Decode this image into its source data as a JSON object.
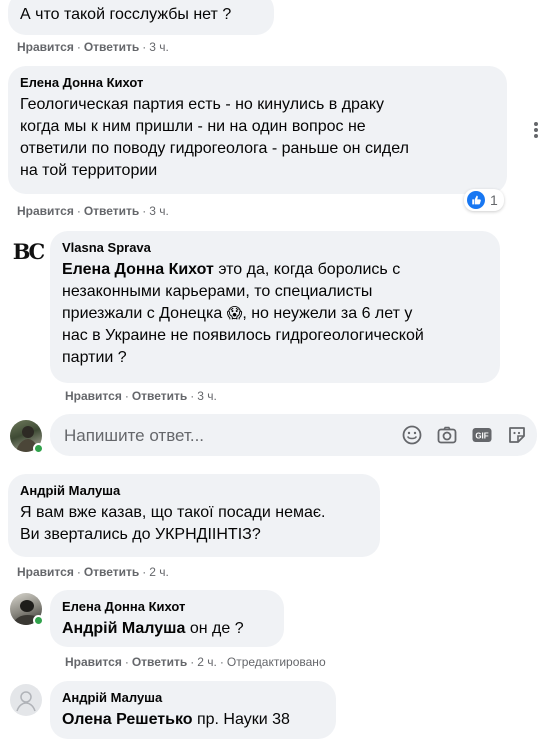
{
  "comments": [
    {
      "text": "А что такой госслужбы нет ?",
      "actions": {
        "like": "Нравится",
        "reply": "Ответить",
        "time": "3 ч."
      }
    },
    {
      "author": "Елена Донна Кихот",
      "text_lines": [
        "Геологическая партия есть - но кинулись в драку",
        "когда мы к ним пришли - ни на один вопрос не",
        "ответили по поводу гидрогеолога - раньше он сидел",
        "на той территории"
      ],
      "reaction_count": "1",
      "actions": {
        "like": "Нравится",
        "reply": "Ответить",
        "time": "3 ч."
      }
    },
    {
      "author": "Vlasna Sprava",
      "avatar_text": "ВС",
      "mention": "Елена Донна Кихот",
      "line1_rest": " это да, когда боролись с",
      "line2": "незаконными карьерами, то специалисты",
      "line3_a": "приезжали с Донецка",
      "emoji": "😱",
      "line3_b": ", но неужели за 6 лет у",
      "line4": "нас в Украине не появилось гидрогеологической",
      "line5": "партии ?",
      "actions": {
        "like": "Нравится",
        "reply": "Ответить",
        "time": "3 ч."
      }
    },
    {
      "author": "Андрій Малуша",
      "text_lines": [
        "Я вам вже казав, що такої посади немає.",
        "Ви звертались до УКРНДІІНТІЗ?"
      ],
      "actions": {
        "like": "Нравится",
        "reply": "Ответить",
        "time": "2 ч."
      }
    },
    {
      "author": "Елена Донна Кихот",
      "mention": "Андрій Малуша",
      "rest": " он де ?",
      "actions": {
        "like": "Нравится",
        "reply": "Ответить",
        "time": "2 ч.",
        "edited": "Отредактировано"
      }
    },
    {
      "author": "Андрій Малуша",
      "mention": "Олена Решетько",
      "rest": " пр. Науки 38"
    }
  ],
  "reply_box": {
    "placeholder": "Напишите ответ..."
  },
  "icons": {
    "emoji": "emoji-icon",
    "camera": "camera-icon",
    "gif": "gif-icon",
    "sticker": "sticker-icon",
    "like": "like-icon",
    "more": "more-options-icon"
  },
  "colors": {
    "bubble": "#f0f2f5",
    "secondary_text": "#65676b",
    "like_blue": "#1877f2",
    "online_green": "#31a24c"
  }
}
